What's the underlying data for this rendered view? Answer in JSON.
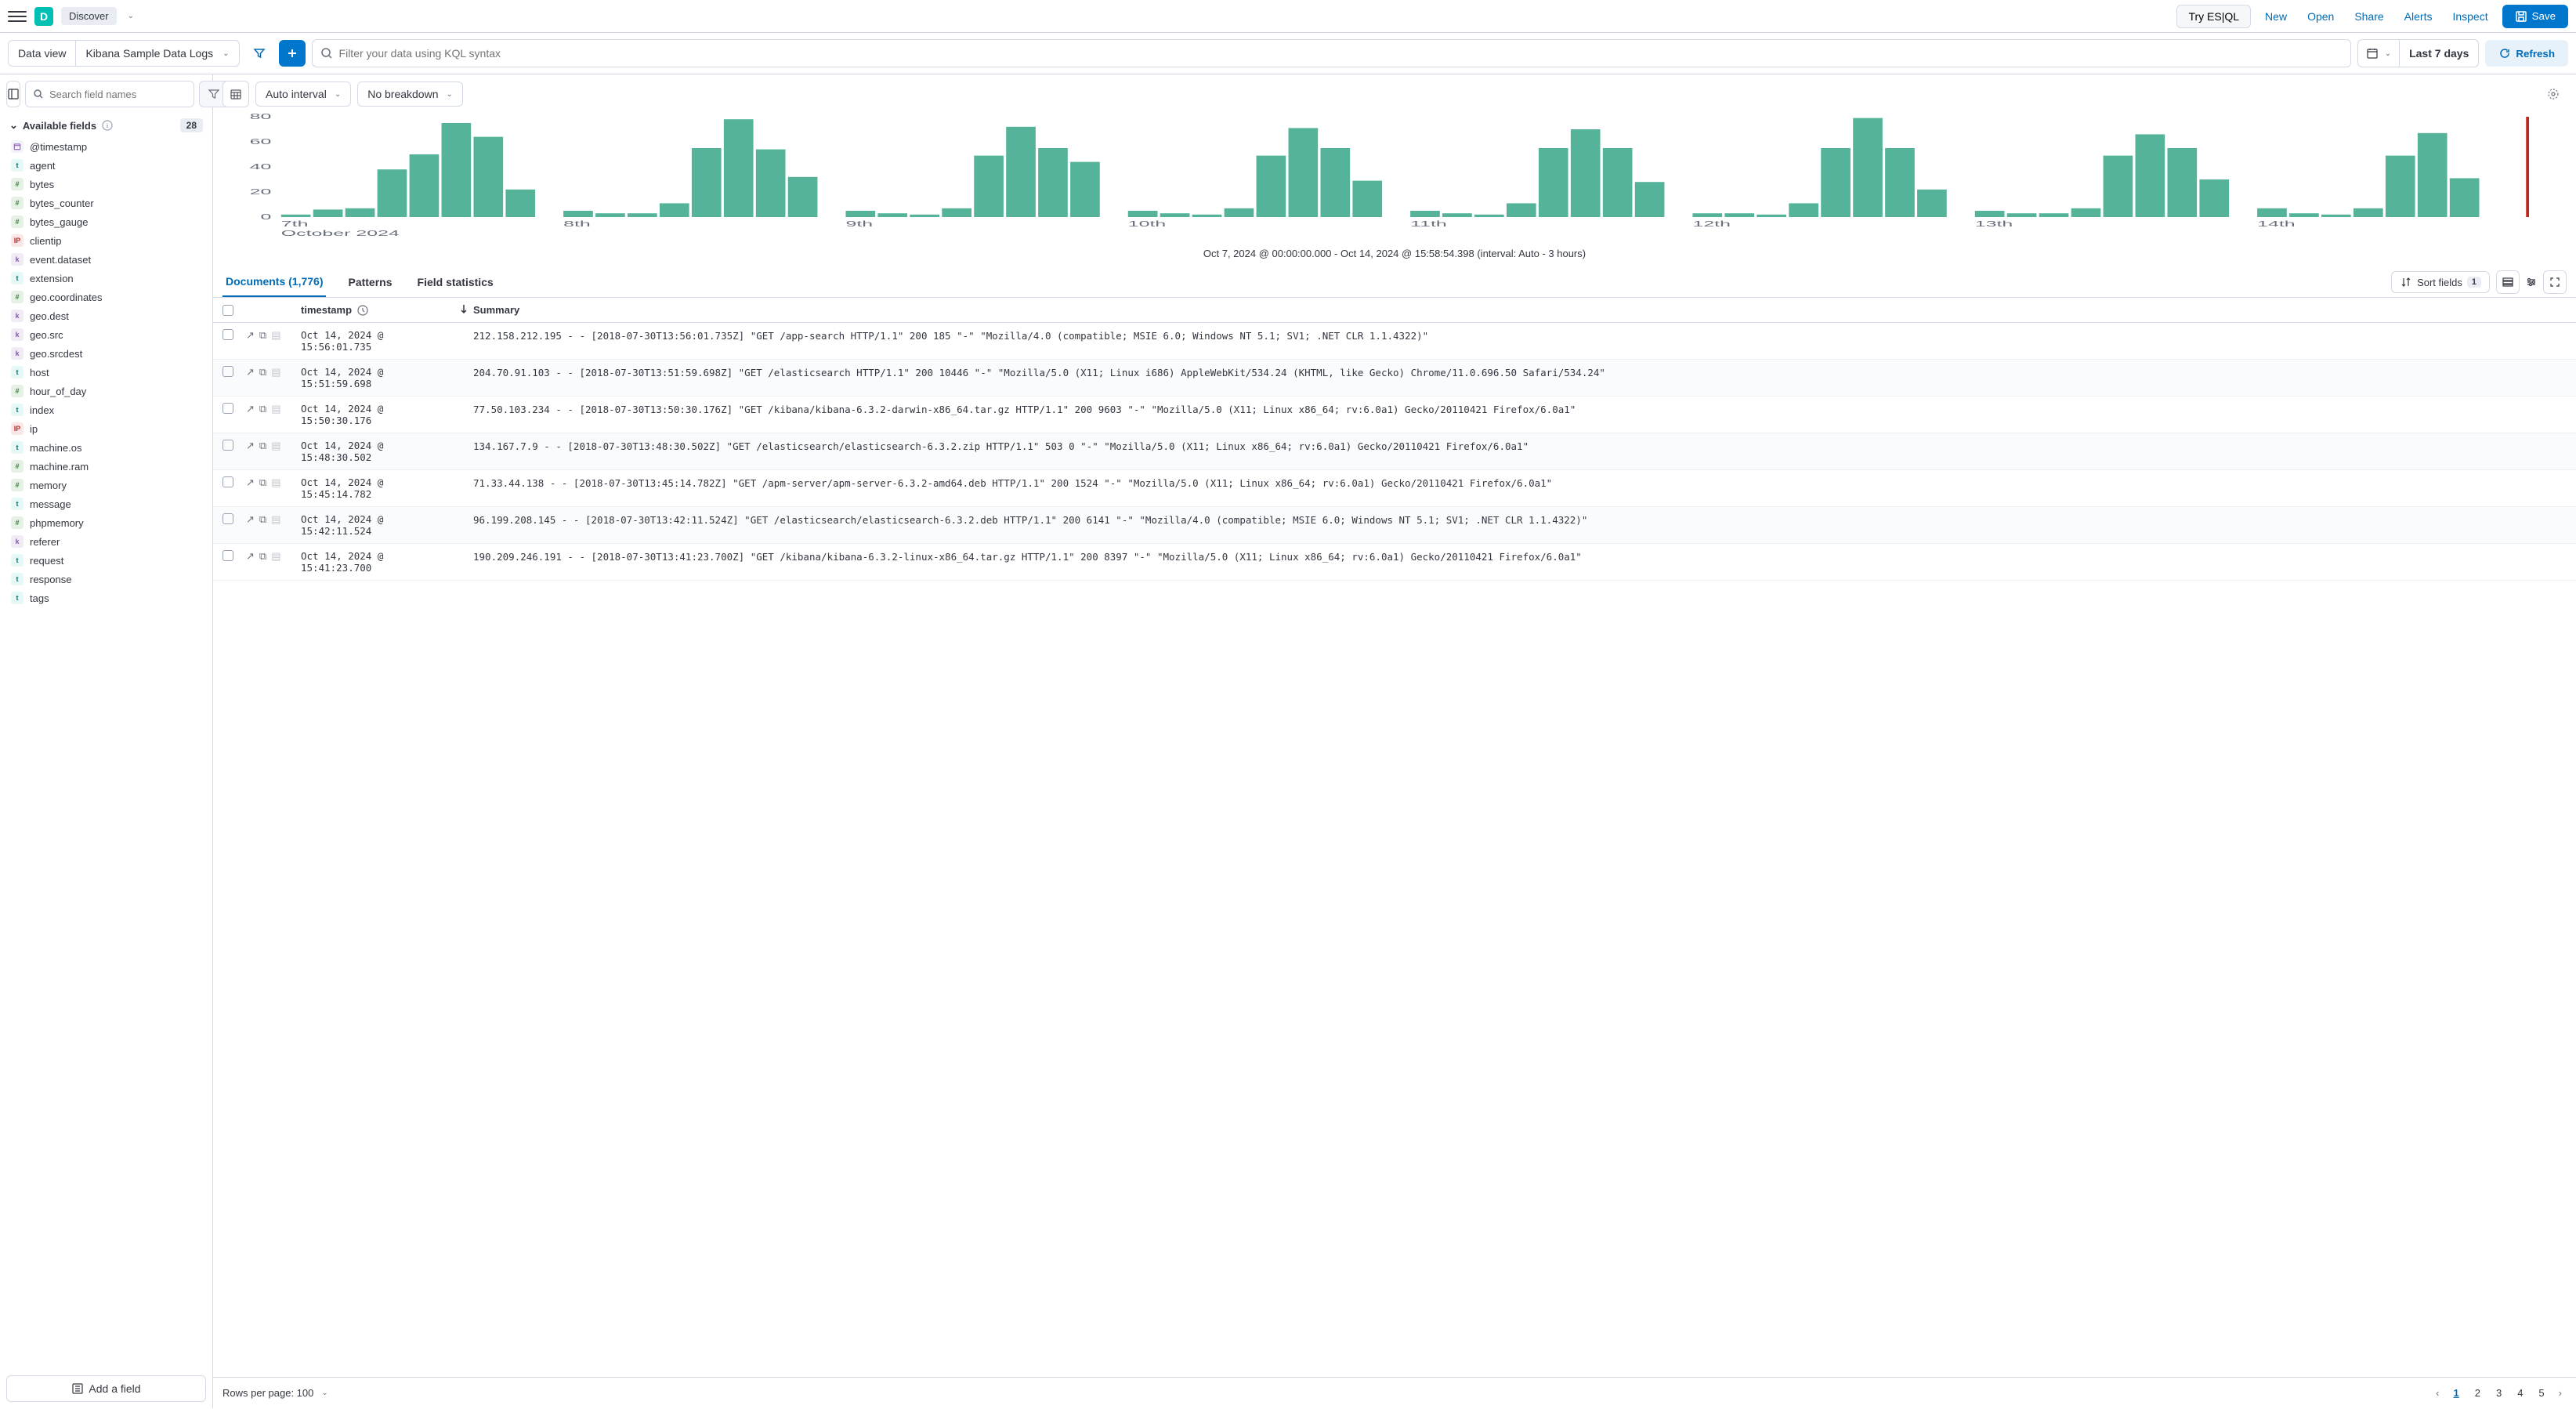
{
  "topbar": {
    "app_title": "Discover",
    "try_esql": "Try ES|QL",
    "links": {
      "new": "New",
      "open": "Open",
      "share": "Share",
      "alerts": "Alerts",
      "inspect": "Inspect"
    },
    "save": "Save"
  },
  "filterbar": {
    "data_view_label": "Data view",
    "data_view_value": "Kibana Sample Data Logs",
    "search_placeholder": "Filter your data using KQL syntax",
    "date_range": "Last 7 days",
    "refresh": "Refresh"
  },
  "sidebar": {
    "search_placeholder": "Search field names",
    "filter_count": "0",
    "section_title": "Available fields",
    "section_count": "28",
    "fields": [
      {
        "type": "date",
        "name": "@timestamp"
      },
      {
        "type": "t",
        "name": "agent"
      },
      {
        "type": "n",
        "name": "bytes"
      },
      {
        "type": "n",
        "name": "bytes_counter"
      },
      {
        "type": "n",
        "name": "bytes_gauge"
      },
      {
        "type": "ip",
        "name": "clientip"
      },
      {
        "type": "k",
        "name": "event.dataset"
      },
      {
        "type": "t",
        "name": "extension"
      },
      {
        "type": "n",
        "name": "geo.coordinates"
      },
      {
        "type": "k",
        "name": "geo.dest"
      },
      {
        "type": "k",
        "name": "geo.src"
      },
      {
        "type": "k",
        "name": "geo.srcdest"
      },
      {
        "type": "t",
        "name": "host"
      },
      {
        "type": "n",
        "name": "hour_of_day"
      },
      {
        "type": "t",
        "name": "index"
      },
      {
        "type": "ip",
        "name": "ip"
      },
      {
        "type": "t",
        "name": "machine.os"
      },
      {
        "type": "n",
        "name": "machine.ram"
      },
      {
        "type": "n",
        "name": "memory"
      },
      {
        "type": "t",
        "name": "message"
      },
      {
        "type": "n",
        "name": "phpmemory"
      },
      {
        "type": "k",
        "name": "referer"
      },
      {
        "type": "t",
        "name": "request"
      },
      {
        "type": "t",
        "name": "response"
      },
      {
        "type": "t",
        "name": "tags"
      }
    ],
    "add_field": "Add a field"
  },
  "chart_controls": {
    "interval": "Auto interval",
    "breakdown": "No breakdown"
  },
  "chart_data": {
    "type": "bar",
    "ylabel": "",
    "ylim": [
      0,
      80
    ],
    "yticks": [
      0,
      20,
      40,
      60,
      80
    ],
    "xticks": [
      "7th",
      "8th",
      "9th",
      "10th",
      "11th",
      "12th",
      "13th",
      "14th"
    ],
    "xlabel_secondary": "October 2024",
    "values": [
      2,
      6,
      7,
      38,
      50,
      75,
      64,
      22,
      5,
      3,
      3,
      11,
      55,
      78,
      54,
      32,
      5,
      3,
      2,
      7,
      49,
      72,
      55,
      44,
      5,
      3,
      2,
      7,
      49,
      71,
      55,
      29,
      5,
      3,
      2,
      11,
      55,
      70,
      55,
      28,
      3,
      3,
      2,
      11,
      55,
      79,
      55,
      22,
      5,
      3,
      3,
      7,
      49,
      66,
      55,
      30,
      7,
      3,
      2,
      7,
      49,
      67,
      31
    ],
    "caption": "Oct 7, 2024 @ 00:00:00.000 - Oct 14, 2024 @ 15:58:54.398 (interval: Auto - 3 hours)"
  },
  "tabs": {
    "documents": "Documents (1,776)",
    "patterns": "Patterns",
    "field_stats": "Field statistics",
    "sort_label": "Sort fields",
    "sort_count": "1"
  },
  "table": {
    "col_timestamp": "timestamp",
    "col_summary": "Summary",
    "rows": [
      {
        "ts": "Oct 14, 2024 @ 15:56:01.735",
        "summary": "212.158.212.195 - - [2018-07-30T13:56:01.735Z] \"GET /app-search HTTP/1.1\" 200 185 \"-\" \"Mozilla/4.0 (compatible; MSIE 6.0; Windows NT 5.1; SV1; .NET CLR 1.1.4322)\""
      },
      {
        "ts": "Oct 14, 2024 @ 15:51:59.698",
        "summary": "204.70.91.103 - - [2018-07-30T13:51:59.698Z] \"GET /elasticsearch HTTP/1.1\" 200 10446 \"-\" \"Mozilla/5.0 (X11; Linux i686) AppleWebKit/534.24 (KHTML, like Gecko) Chrome/11.0.696.50 Safari/534.24\""
      },
      {
        "ts": "Oct 14, 2024 @ 15:50:30.176",
        "summary": "77.50.103.234 - - [2018-07-30T13:50:30.176Z] \"GET /kibana/kibana-6.3.2-darwin-x86_64.tar.gz HTTP/1.1\" 200 9603 \"-\" \"Mozilla/5.0 (X11; Linux x86_64; rv:6.0a1) Gecko/20110421 Firefox/6.0a1\""
      },
      {
        "ts": "Oct 14, 2024 @ 15:48:30.502",
        "summary": "134.167.7.9 - - [2018-07-30T13:48:30.502Z] \"GET /elasticsearch/elasticsearch-6.3.2.zip HTTP/1.1\" 503 0 \"-\" \"Mozilla/5.0 (X11; Linux x86_64; rv:6.0a1) Gecko/20110421 Firefox/6.0a1\""
      },
      {
        "ts": "Oct 14, 2024 @ 15:45:14.782",
        "summary": "71.33.44.138 - - [2018-07-30T13:45:14.782Z] \"GET /apm-server/apm-server-6.3.2-amd64.deb HTTP/1.1\" 200 1524 \"-\" \"Mozilla/5.0 (X11; Linux x86_64; rv:6.0a1) Gecko/20110421 Firefox/6.0a1\""
      },
      {
        "ts": "Oct 14, 2024 @ 15:42:11.524",
        "summary": "96.199.208.145 - - [2018-07-30T13:42:11.524Z] \"GET /elasticsearch/elasticsearch-6.3.2.deb HTTP/1.1\" 200 6141 \"-\" \"Mozilla/4.0 (compatible; MSIE 6.0; Windows NT 5.1; SV1; .NET CLR 1.1.4322)\""
      },
      {
        "ts": "Oct 14, 2024 @ 15:41:23.700",
        "summary": "190.209.246.191 - - [2018-07-30T13:41:23.700Z] \"GET /kibana/kibana-6.3.2-linux-x86_64.tar.gz HTTP/1.1\" 200 8397 \"-\" \"Mozilla/5.0 (X11; Linux x86_64; rv:6.0a1) Gecko/20110421 Firefox/6.0a1\""
      }
    ]
  },
  "pager": {
    "rows_label": "Rows per page: 100",
    "pages": [
      "1",
      "2",
      "3",
      "4",
      "5"
    ],
    "active": "1"
  }
}
